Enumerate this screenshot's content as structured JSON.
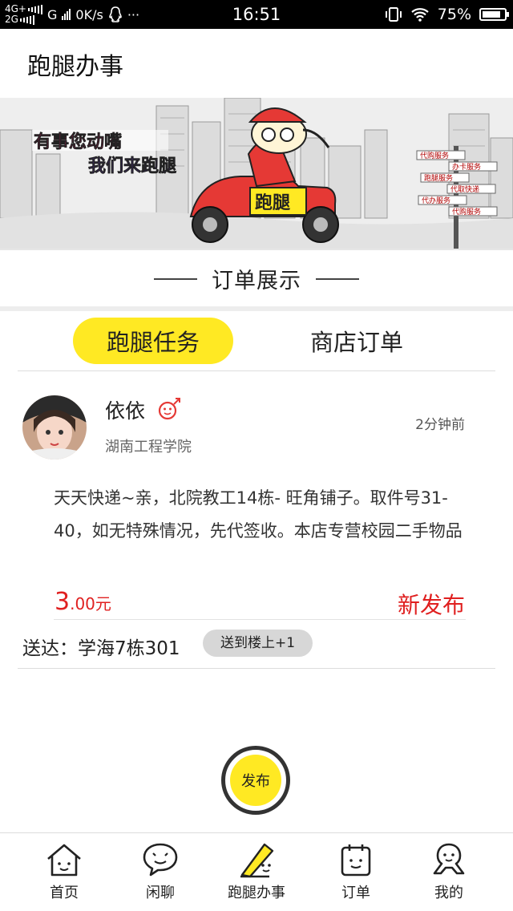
{
  "status_bar": {
    "net_top": "4G+",
    "net_bottom": "2G",
    "carrier": "G",
    "speed": "0K/s",
    "more": "···",
    "time": "16:51",
    "battery": "75%"
  },
  "header": {
    "title": "跑腿办事"
  },
  "banner": {
    "slogan_line1": "有事您动嘴",
    "slogan_line2": "我们来跑腿",
    "scooter_label": "跑腿",
    "sign_texts": [
      "代购服务",
      "办卡服务",
      "跑腿服务",
      "代取快递",
      "代办服务",
      "代购服务"
    ]
  },
  "section": {
    "title": "订单展示"
  },
  "tabs": [
    {
      "label": "跑腿任务",
      "active": true
    },
    {
      "label": "商店订单",
      "active": false
    }
  ],
  "order": {
    "user_name": "依依",
    "school": "湖南工程学院",
    "time_ago": "2分钟前",
    "description": "天天快递~亲，北院教工14栋- 旺角铺子。取件号31-40，如无特殊情况，先代签收。本店专营校园二手物品",
    "price_integer": "3",
    "price_decimal": ".00元",
    "status": "新发布",
    "destination": "送达：学海7栋301",
    "destination_note": "送到楼上+1"
  },
  "publish_button": {
    "label": "发布"
  },
  "bottom_nav": [
    {
      "label": "首页",
      "icon": "home-icon"
    },
    {
      "label": "闲聊",
      "icon": "chat-icon"
    },
    {
      "label": "跑腿办事",
      "icon": "errand-icon",
      "active": true
    },
    {
      "label": "订单",
      "icon": "order-icon"
    },
    {
      "label": "我的",
      "icon": "profile-icon"
    }
  ],
  "colors": {
    "accent_yellow": "#ffe923",
    "price_red": "#e02020",
    "status_bar": "#000000"
  }
}
